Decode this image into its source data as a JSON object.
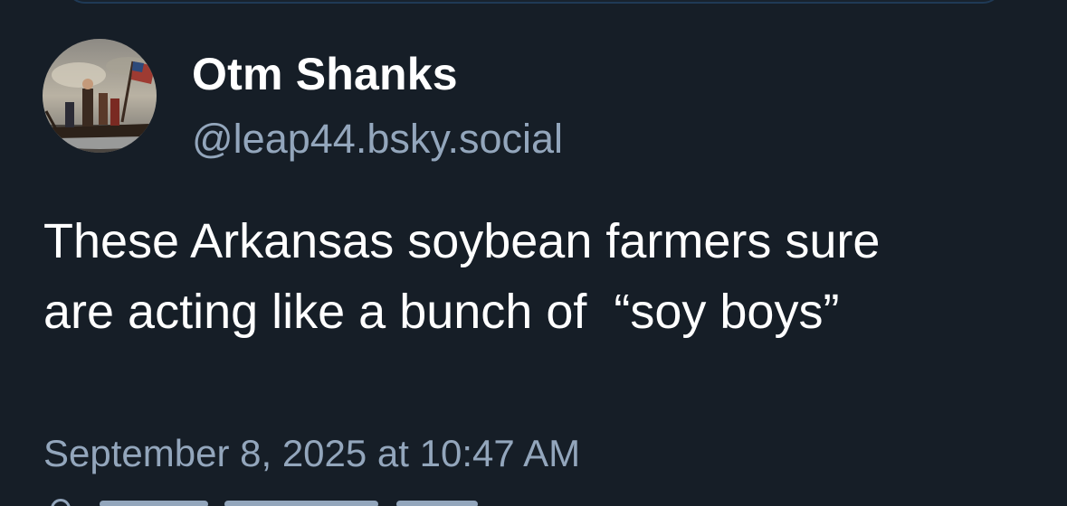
{
  "post": {
    "author": {
      "display_name": "Otm Shanks",
      "handle": "@leap44.bsky.social",
      "avatar": "avatar-painting-icon"
    },
    "text": "These Arkansas soybean farmers sure\nare acting like a bunch of  “soy boys”",
    "timestamp": "September 8, 2025 at 10:47 AM"
  },
  "colors": {
    "background": "#161e27",
    "text_primary": "#ffffff",
    "text_secondary": "#93a6bc",
    "top_box_border": "#1f3a56"
  }
}
